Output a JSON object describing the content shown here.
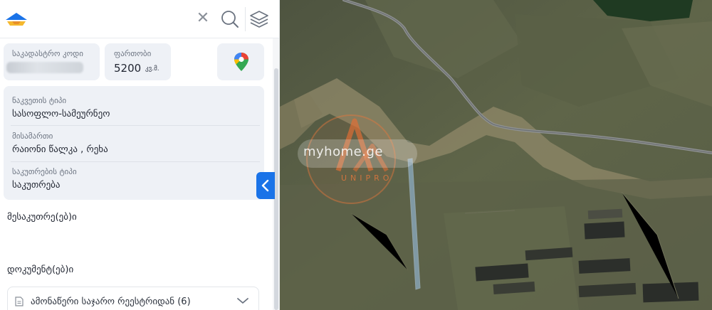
{
  "search": {
    "clear_icon": "close-icon",
    "search_icon": "search-icon",
    "layers_icon": "layers-icon"
  },
  "property": {
    "cadastral_code_label": "საკადასტრო კოდი",
    "area_label": "ფართობი",
    "area_value": "5200",
    "area_unit": "კვ.მ.",
    "maps_icon": "google-maps-pin-icon"
  },
  "details": [
    {
      "label": "ნაკვეთის ტიპი",
      "value": "სასოფლო-სამეურნეო"
    },
    {
      "label": "მისამართი",
      "value": "რაიონი წალკა , რეხა"
    },
    {
      "label": "საკუთრების ტიპი",
      "value": "საკუთრება"
    }
  ],
  "owners_title": "მესაკუთრე(ებ)ი",
  "documents_title": "დოკუმენტ(ებ)ი",
  "document_item": "ამონაწერი საჯარო რეესტრიდან (6)",
  "watermark": {
    "brand": "myhome.ge",
    "sub": "UNIPRO"
  },
  "colors": {
    "accent": "#1a73e8",
    "card_bg": "#eef1f6",
    "parcel": "#9ec7f0"
  }
}
